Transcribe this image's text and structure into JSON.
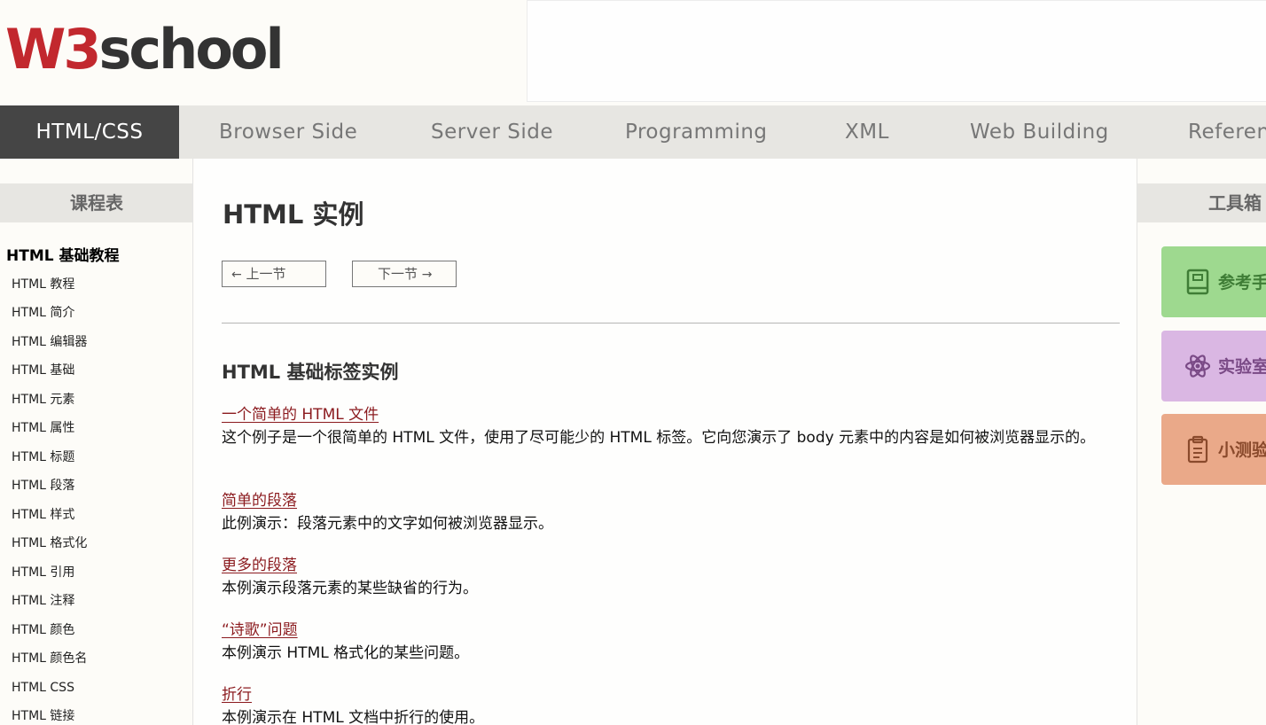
{
  "header": {
    "logo_w3": "W3",
    "logo_school": "school"
  },
  "nav": {
    "items": [
      "HTML/CSS",
      "Browser Side",
      "Server Side",
      "Programming",
      "XML",
      "Web Building",
      "Referen"
    ],
    "active_index": 0
  },
  "left_sidebar": {
    "heading": "课程表",
    "group_title": "HTML 基础教程",
    "items": [
      "HTML 教程",
      "HTML 简介",
      "HTML 编辑器",
      "HTML 基础",
      "HTML 元素",
      "HTML 属性",
      "HTML 标题",
      "HTML 段落",
      "HTML 样式",
      "HTML 格式化",
      "HTML 引用",
      "HTML 注释",
      "HTML 颜色",
      "HTML 颜色名",
      "HTML CSS",
      "HTML 链接"
    ]
  },
  "main": {
    "title": "HTML 实例",
    "prev_label": "上一节",
    "next_label": "下一节",
    "section_title": "HTML 基础标签实例",
    "examples": [
      {
        "link": "一个简单的 HTML 文件",
        "desc": "这个例子是一个很简单的 HTML 文件，使用了尽可能少的 HTML 标签。它向您演示了 body 元素中的内容是如何被浏览器显示的。"
      },
      {
        "link": "简单的段落",
        "desc": "此例演示：段落元素中的文字如何被浏览器显示。"
      },
      {
        "link": "更多的段落",
        "desc": "本例演示段落元素的某些缺省的行为。"
      },
      {
        "link": "“诗歌”问题",
        "desc": "本例演示 HTML 格式化的某些问题。"
      },
      {
        "link": "折行",
        "desc": "本例演示在 HTML 文档中折行的使用。"
      }
    ]
  },
  "right_sidebar": {
    "heading": "工具箱",
    "cards": [
      {
        "label": "参考手",
        "icon": "book-icon"
      },
      {
        "label": "实验室",
        "icon": "atom-icon"
      },
      {
        "label": "小测验",
        "icon": "clipboard-icon"
      }
    ]
  }
}
